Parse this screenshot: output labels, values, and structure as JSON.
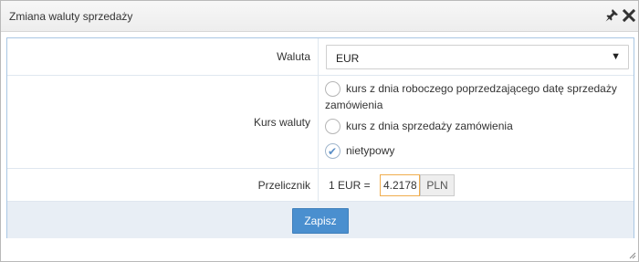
{
  "dialog": {
    "title": "Zmiana waluty sprzedaży",
    "pin_icon": "pin-icon",
    "close_icon": "close-icon"
  },
  "form": {
    "currency": {
      "label": "Waluta",
      "value": "EUR"
    },
    "rate": {
      "label": "Kurs waluty",
      "options": [
        {
          "line1": "kurs z dnia roboczego poprzedzającego datę sprzedaży",
          "line2": "zamówienia",
          "checked": false
        },
        {
          "line1": "kurs z dnia sprzedaży zamówienia",
          "checked": false
        },
        {
          "line1": "nietypowy",
          "checked": true
        }
      ]
    },
    "converter": {
      "label": "Przelicznik",
      "prefix": "1 EUR =",
      "value": "4.2178",
      "suffix": "PLN"
    },
    "save_label": "Zapisz"
  },
  "colors": {
    "accent": "#4a8fcf",
    "focus_border": "#f0ad4e",
    "footer_bg": "#e8eef5"
  }
}
